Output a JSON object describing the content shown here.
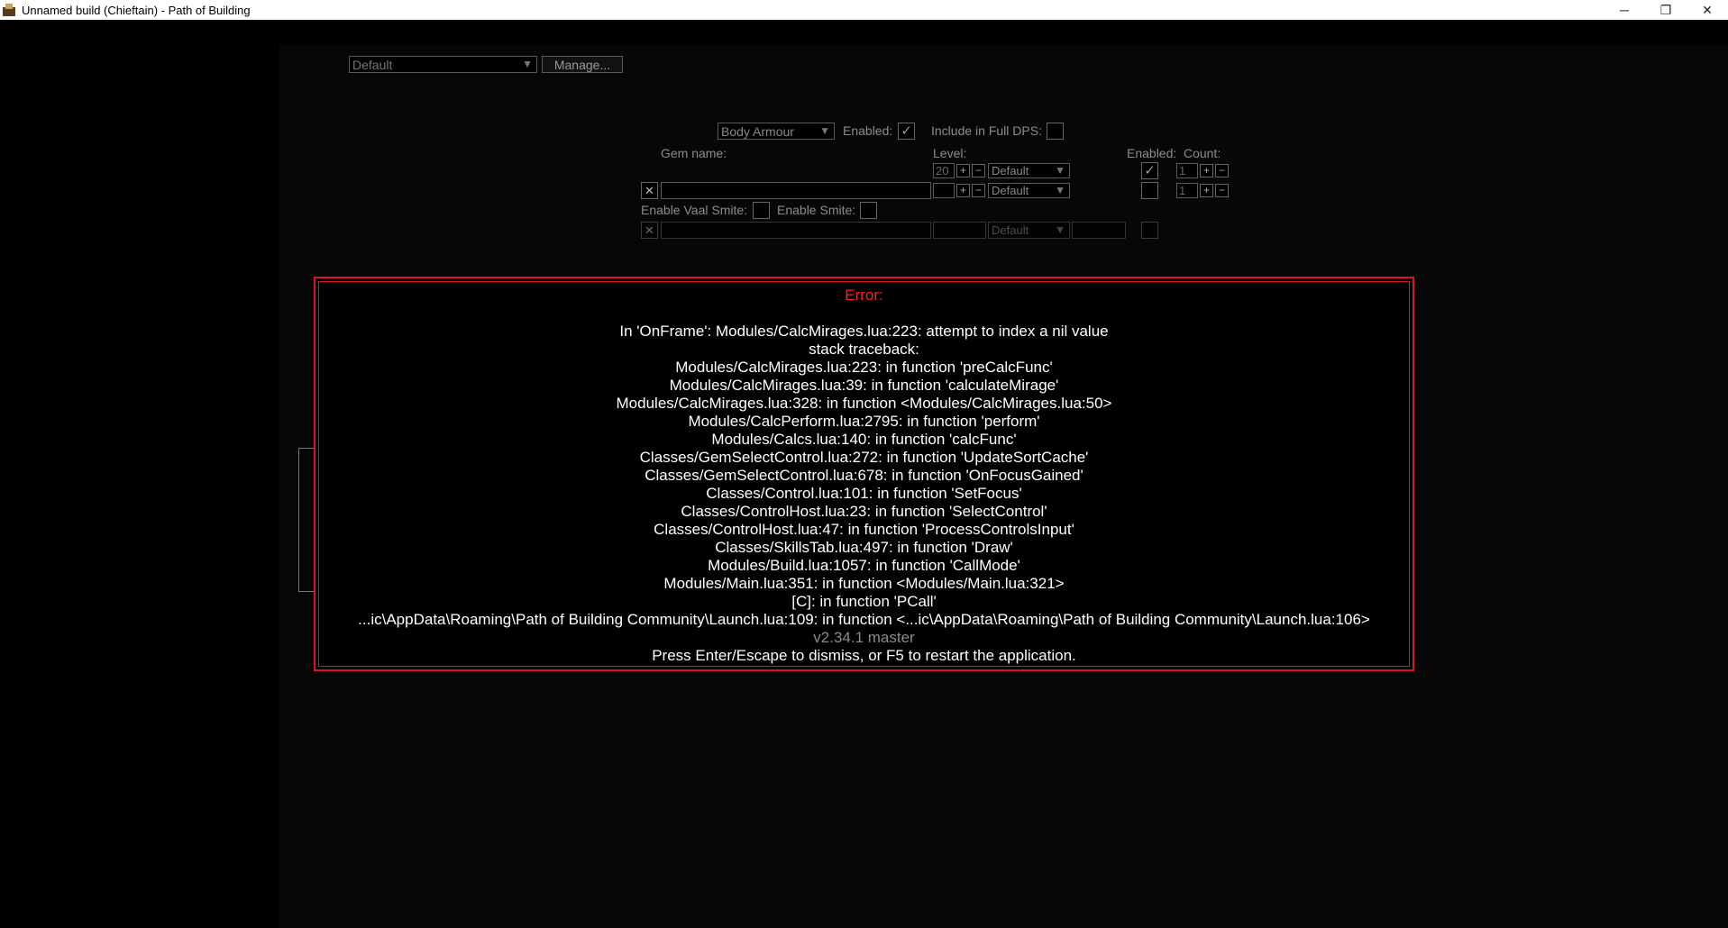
{
  "window": {
    "title": "Unnamed build (Chieftain) - Path of Building",
    "minimize": "─",
    "restore": "❐",
    "close": "✕"
  },
  "toolbar": {
    "skill_set_value": "Default",
    "manage_label": "Manage..."
  },
  "socket_group": {
    "slot_value": "Body Armour",
    "enabled_label": "Enabled:",
    "full_dps_label": "Include in Full DPS:",
    "gem_name_header": "Gem name:",
    "level_header": "Level:",
    "enabled_header": "Enabled:",
    "count_header": "Count:",
    "rows": [
      {
        "level": "20",
        "quality": "Default",
        "count": "1"
      },
      {
        "level": "",
        "quality": "Default",
        "count": "1"
      }
    ],
    "vaal_smite_label": "Enable Vaal Smite:",
    "smite_label": "Enable Smite:",
    "extra_row_quality": "Default"
  },
  "error": {
    "title": "Error:",
    "lines": [
      "In 'OnFrame': Modules/CalcMirages.lua:223: attempt to index a nil value",
      "stack traceback:",
      "Modules/CalcMirages.lua:223: in function 'preCalcFunc'",
      "Modules/CalcMirages.lua:39: in function 'calculateMirage'",
      "Modules/CalcMirages.lua:328: in function <Modules/CalcMirages.lua:50>",
      "Modules/CalcPerform.lua:2795: in function 'perform'",
      "Modules/Calcs.lua:140: in function 'calcFunc'",
      "Classes/GemSelectControl.lua:272: in function 'UpdateSortCache'",
      "Classes/GemSelectControl.lua:678: in function 'OnFocusGained'",
      "Classes/Control.lua:101: in function 'SetFocus'",
      "Classes/ControlHost.lua:23: in function 'SelectControl'",
      "Classes/ControlHost.lua:47: in function 'ProcessControlsInput'",
      "Classes/SkillsTab.lua:497: in function 'Draw'",
      "Modules/Build.lua:1057: in function 'CallMode'",
      "Modules/Main.lua:351: in function <Modules/Main.lua:321>",
      "[C]: in function 'PCall'",
      "...ic\\AppData\\Roaming\\Path of Building Community\\Launch.lua:109: in function <...ic\\AppData\\Roaming\\Path of Building Community\\Launch.lua:106>"
    ],
    "version": "v2.34.1 master",
    "hint": "Press Enter/Escape to dismiss, or F5 to restart the application."
  }
}
